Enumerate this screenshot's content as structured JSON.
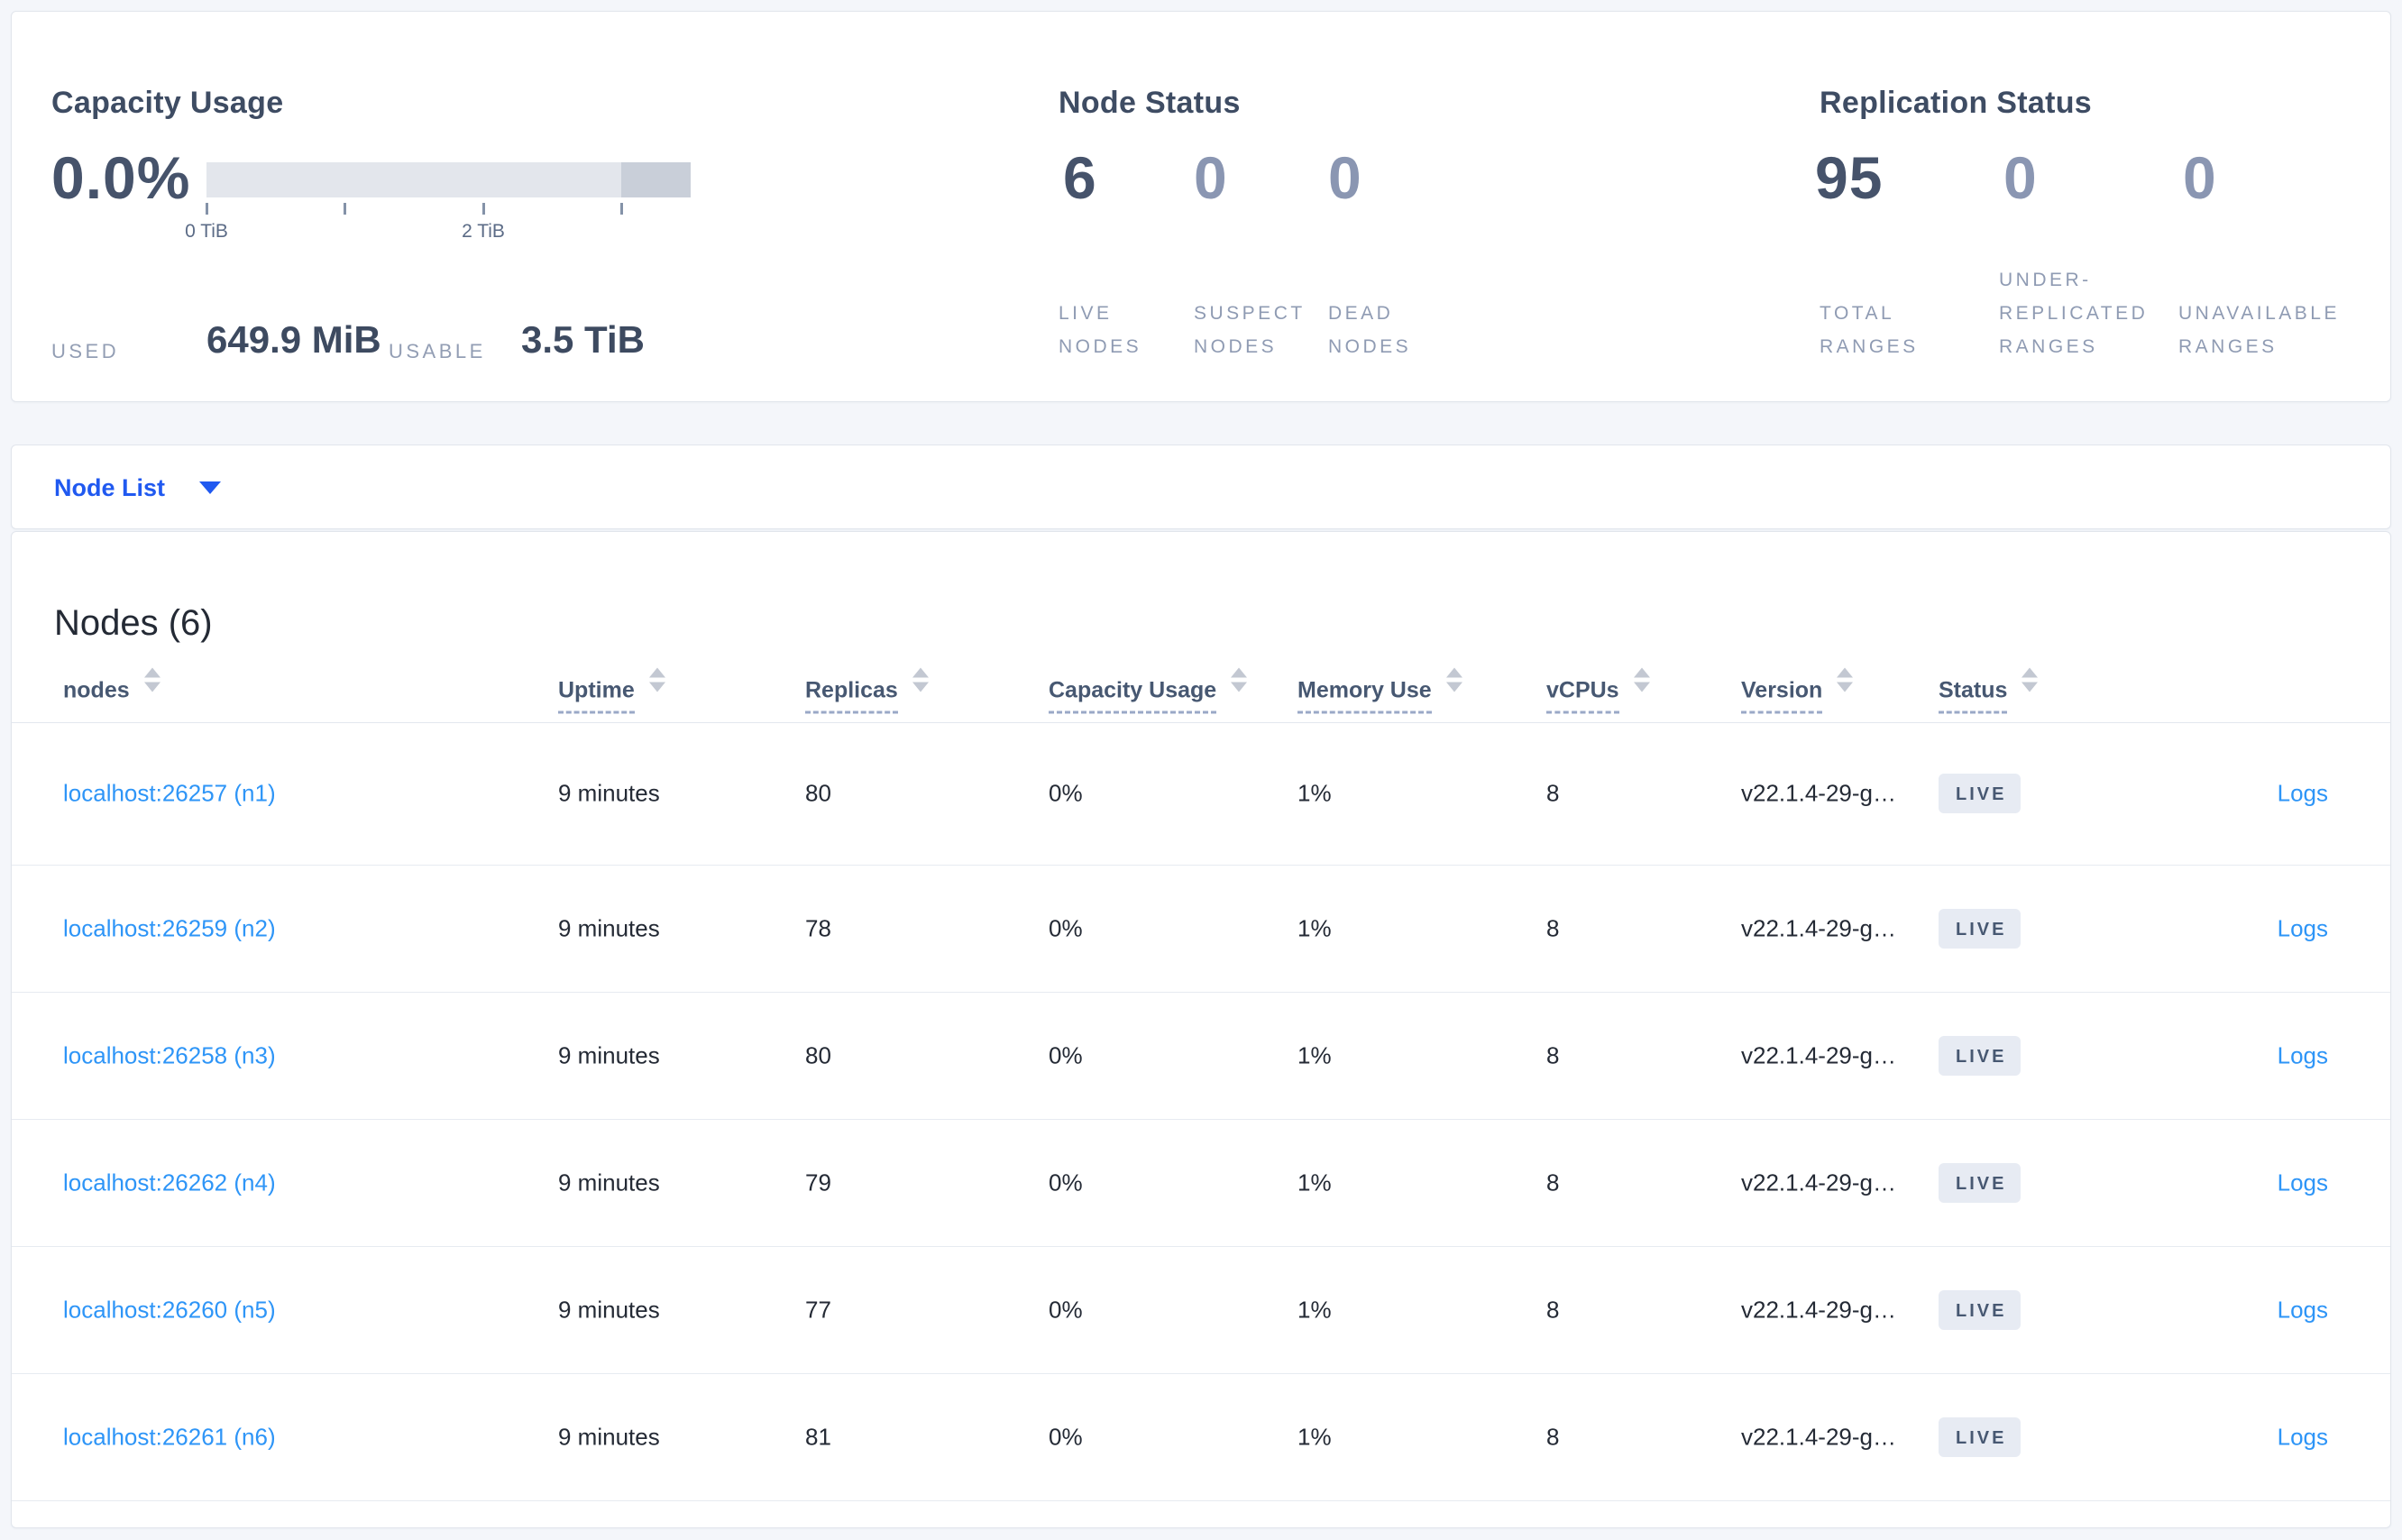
{
  "page": {
    "background": "#f4f6fa"
  },
  "overview": {
    "capacity": {
      "title": "Capacity Usage",
      "percent": "0.0%",
      "tick_labels": [
        "0 TiB",
        "2 TiB"
      ],
      "used_label": "USED",
      "used_value": "649.9 MiB",
      "usable_label": "USABLE",
      "usable_value": "3.5 TiB"
    },
    "node_status": {
      "title": "Node Status",
      "stats": [
        {
          "value": "6",
          "label": "LIVE\nNODES",
          "muted": false
        },
        {
          "value": "0",
          "label": "SUSPECT\nNODES",
          "muted": true
        },
        {
          "value": "0",
          "label": "DEAD\nNODES",
          "muted": true
        }
      ]
    },
    "replication_status": {
      "title": "Replication Status",
      "stats": [
        {
          "value": "95",
          "label": "TOTAL\nRANGES",
          "muted": false
        },
        {
          "value": "0",
          "label": "UNDER-\nREPLICATED\nRANGES",
          "muted": true
        },
        {
          "value": "0",
          "label": "UNAVAILABLE\nRANGES",
          "muted": true
        }
      ]
    }
  },
  "view_selector": {
    "label": "Node List",
    "icon": "caret-down-icon"
  },
  "nodes_section": {
    "title": "Nodes (6)",
    "columns": [
      {
        "key": "node",
        "label": "nodes",
        "dashed": false
      },
      {
        "key": "uptime",
        "label": "Uptime",
        "dashed": true
      },
      {
        "key": "replicas",
        "label": "Replicas",
        "dashed": true
      },
      {
        "key": "capacity",
        "label": "Capacity Usage",
        "dashed": true
      },
      {
        "key": "memory",
        "label": "Memory Use",
        "dashed": true
      },
      {
        "key": "vcpus",
        "label": "vCPUs",
        "dashed": true
      },
      {
        "key": "version",
        "label": "Version",
        "dashed": true
      },
      {
        "key": "status",
        "label": "Status",
        "dashed": true
      }
    ],
    "logs_label": "Logs",
    "rows": [
      {
        "node": "localhost:26257 (n1)",
        "uptime": "9 minutes",
        "replicas": "80",
        "capacity": "0%",
        "memory": "1%",
        "vcpus": "8",
        "version": "v22.1.4-29-g…",
        "status": "LIVE"
      },
      {
        "node": "localhost:26259 (n2)",
        "uptime": "9 minutes",
        "replicas": "78",
        "capacity": "0%",
        "memory": "1%",
        "vcpus": "8",
        "version": "v22.1.4-29-g…",
        "status": "LIVE"
      },
      {
        "node": "localhost:26258 (n3)",
        "uptime": "9 minutes",
        "replicas": "80",
        "capacity": "0%",
        "memory": "1%",
        "vcpus": "8",
        "version": "v22.1.4-29-g…",
        "status": "LIVE"
      },
      {
        "node": "localhost:26262 (n4)",
        "uptime": "9 minutes",
        "replicas": "79",
        "capacity": "0%",
        "memory": "1%",
        "vcpus": "8",
        "version": "v22.1.4-29-g…",
        "status": "LIVE"
      },
      {
        "node": "localhost:26260 (n5)",
        "uptime": "9 minutes",
        "replicas": "77",
        "capacity": "0%",
        "memory": "1%",
        "vcpus": "8",
        "version": "v22.1.4-29-g…",
        "status": "LIVE"
      },
      {
        "node": "localhost:26261 (n6)",
        "uptime": "9 minutes",
        "replicas": "81",
        "capacity": "0%",
        "memory": "1%",
        "vcpus": "8",
        "version": "v22.1.4-29-g…",
        "status": "LIVE"
      }
    ]
  },
  "colors": {
    "selector_blue": "#2059f0",
    "link_blue": "#2e95f7",
    "badge_bg": "#e7ebf3",
    "badge_text": "#475872",
    "stat_dark": "#46536b",
    "stat_muted": "#8a96b2",
    "bar_bg": "#e3e6ec",
    "bar_dark_segment": "#c9cfd9"
  }
}
